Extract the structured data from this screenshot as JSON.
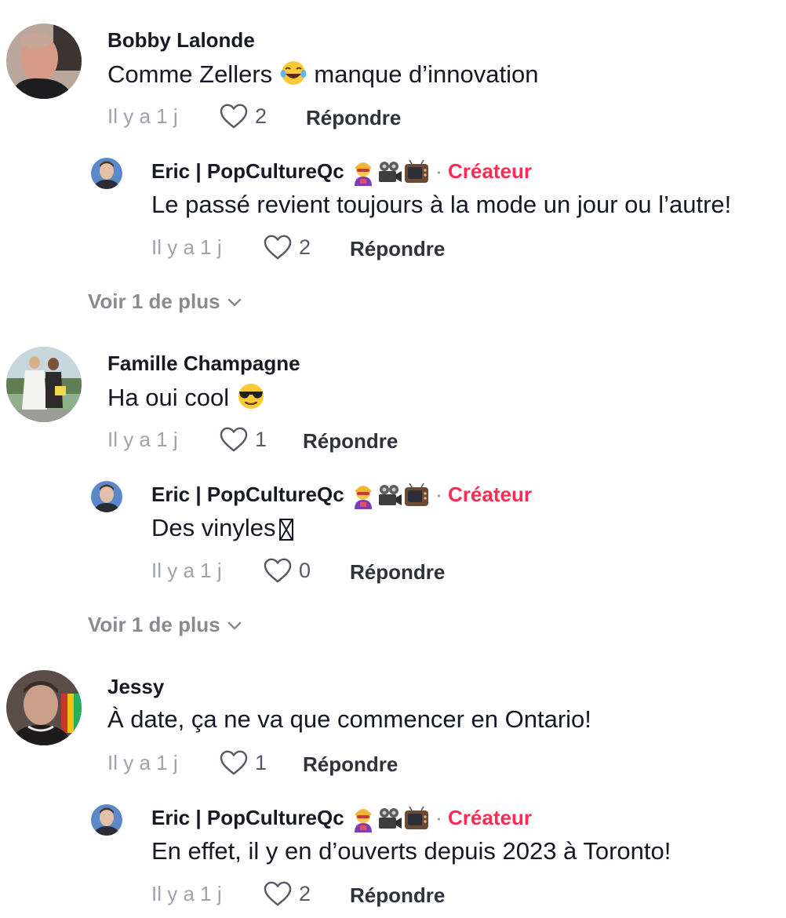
{
  "comments": [
    {
      "username": "Bobby Lalonde",
      "text": "Comme Zellers",
      "text_after_emoji": "manque d’innovation",
      "emoji": "tears-of-joy",
      "time": "Il y a 1 j",
      "likes": "2",
      "reply_label": "Répondre",
      "reply": {
        "username": "Eric | PopCultureQc",
        "creator_label": "Créateur",
        "text": "Le passé revient toujours à la mode un jour ou l’autre!",
        "time": "Il y a 1 j",
        "likes": "2",
        "reply_label": "Répondre"
      },
      "more_label": "Voir 1 de plus"
    },
    {
      "username": "Famille Champagne",
      "text": "Ha oui cool",
      "emoji": "sunglasses-face",
      "time": "Il y a 1 j",
      "likes": "1",
      "reply_label": "Répondre",
      "reply": {
        "username": "Eric | PopCultureQc",
        "creator_label": "Créateur",
        "text": "Des vinyles",
        "time": "Il y a 1 j",
        "likes": "0",
        "reply_label": "Répondre"
      },
      "more_label": "Voir 1 de plus"
    },
    {
      "username": "Jessy",
      "text": "À date, ça ne va que commencer en Ontario!",
      "time": "Il y a 1 j",
      "likes": "1",
      "reply_label": "Répondre",
      "reply": {
        "username": "Eric | PopCultureQc",
        "creator_label": "Créateur",
        "text": "En effet, il y en d’ouverts depuis 2023 à Toronto!",
        "time": "Il y a 1 j",
        "likes": "2",
        "reply_label": "Répondre"
      }
    }
  ],
  "username_emojis": [
    "superhero-icon",
    "movie-camera-icon",
    "television-icon"
  ],
  "colors": {
    "creator": "#fe2c55",
    "muted": "#a0a3ab",
    "text": "#161823"
  }
}
